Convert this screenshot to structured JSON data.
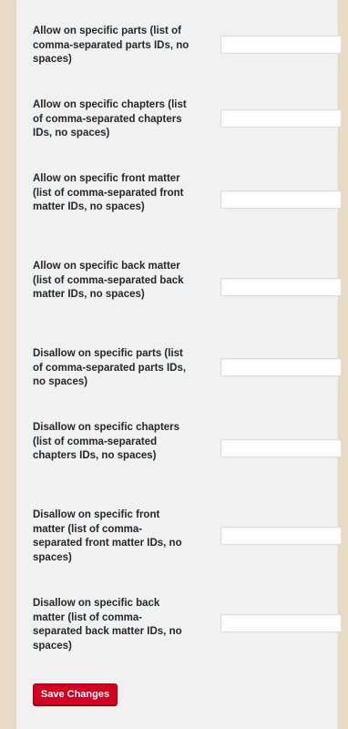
{
  "settings": {
    "rows": [
      {
        "label": "Allow on specific parts (list of comma-separated parts IDs, no spaces)",
        "value": ""
      },
      {
        "label": "Allow on specific chapters (list of comma-separated chapters IDs, no spaces)",
        "value": ""
      },
      {
        "label": "Allow on specific front matter (list of comma-separated front matter IDs, no spaces)",
        "value": ""
      },
      {
        "label": "Allow on specific back matter (list of comma-separated back matter IDs, no spaces)",
        "value": ""
      },
      {
        "label": "Disallow on specific parts (list of comma-separated parts IDs, no spaces)",
        "value": ""
      },
      {
        "label": "Disallow on specific chapters (list of comma-separated chapters IDs, no spaces)",
        "value": ""
      },
      {
        "label": "Disallow on specific front matter (list of comma-separated front matter IDs, no spaces)",
        "value": ""
      },
      {
        "label": "Disallow on specific back matter (list of comma-separated back matter IDs, no spaces)",
        "value": ""
      }
    ],
    "save_label": "Save Changes"
  },
  "colors": {
    "page_background": "#e9dcc6",
    "panel_background": "#f1f1f1",
    "button_background": "#d4001f",
    "button_text": "#ffffff",
    "label_text": "#23282d"
  }
}
